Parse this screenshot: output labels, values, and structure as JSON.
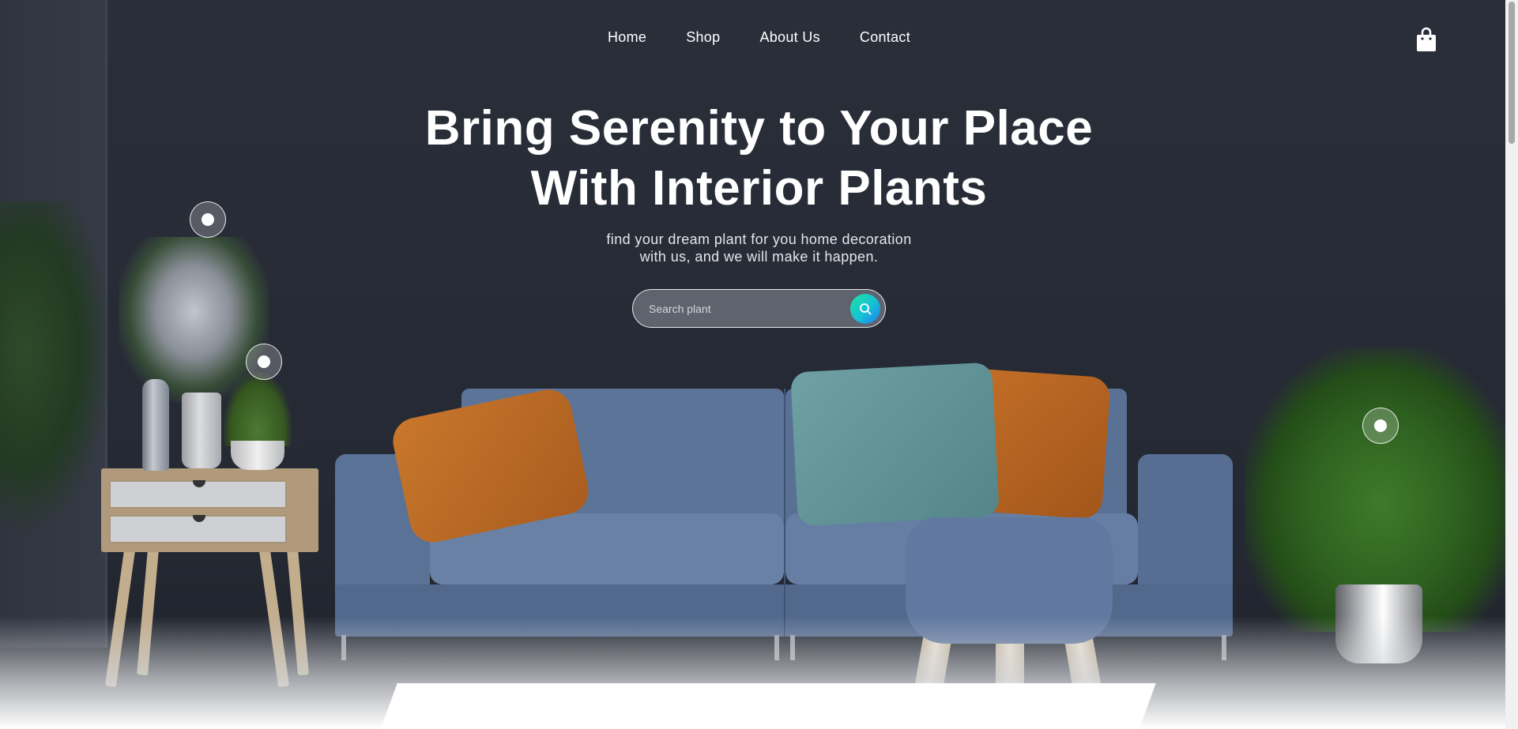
{
  "nav": {
    "items": [
      {
        "label": "Home"
      },
      {
        "label": "Shop"
      },
      {
        "label": "About Us"
      },
      {
        "label": "Contact"
      }
    ],
    "cart_icon": "shopping-bag-icon"
  },
  "hero": {
    "title_line1": "Bring Serenity to Your Place",
    "title_line2": "With Interior Plants",
    "subtitle_line1": "find your dream plant for you home decoration",
    "subtitle_line2": "with us, and we will make it happen."
  },
  "search": {
    "placeholder": "Search plant",
    "value": "",
    "icon": "search-icon"
  },
  "colors": {
    "background": "#272b36",
    "text": "#ffffff",
    "accent_gradient_start": "#1ee3a0",
    "accent_gradient_end": "#1f7bf0"
  },
  "hotspots": {
    "icon": "hotspot-dot-icon",
    "count": 3
  }
}
